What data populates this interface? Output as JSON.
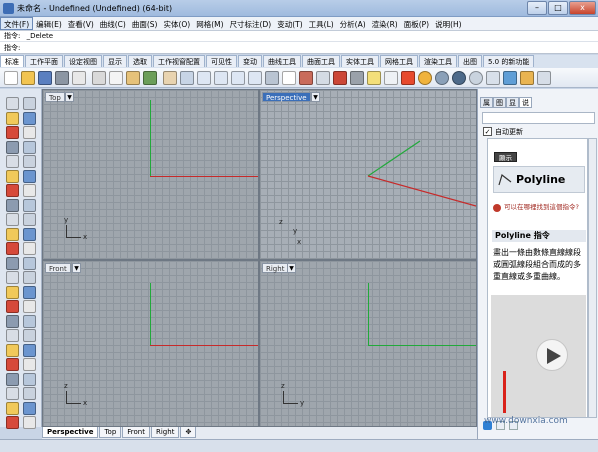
{
  "window": {
    "title": "未命名 - Undefined (Undefined) (64-bit)",
    "buttons": {
      "minimize": "–",
      "maximize": "□",
      "close": "x"
    }
  },
  "menu": [
    "文件(F)",
    "编辑(E)",
    "查看(V)",
    "曲线(C)",
    "曲面(S)",
    "实体(O)",
    "网格(M)",
    "尺寸标注(D)",
    "变动(T)",
    "工具(L)",
    "分析(A)",
    "渲染(R)",
    "面板(P)",
    "说明(H)"
  ],
  "command": {
    "history_label": "指令:",
    "history_value": "_Delete",
    "prompt_label": "指令:"
  },
  "toolbar_tabs": [
    "标准",
    "工作平面",
    "设定视图",
    "显示",
    "选取",
    "工作视窗配置",
    "可见性",
    "变动",
    "曲线工具",
    "曲面工具",
    "实体工具",
    "网格工具",
    "渲染工具",
    "出图",
    "5.0 的新功能"
  ],
  "viewports": {
    "top": {
      "label": "Top",
      "axis_x": "x",
      "axis_y": "y"
    },
    "perspective": {
      "label": "Perspective",
      "axis_x": "x",
      "axis_y": "y",
      "axis_z": "z"
    },
    "front": {
      "label": "Front",
      "axis_x": "x",
      "axis_z": "z"
    },
    "right": {
      "label": "Right",
      "axis_y": "y",
      "axis_z": "z"
    }
  },
  "viewport_tabs": [
    "Perspective",
    "Top",
    "Front",
    "Right"
  ],
  "viewport_tab_add": "✥",
  "right_panel": {
    "tabs": [
      "属",
      "图",
      "显",
      "说"
    ],
    "auto_update_label": "自动更新",
    "auto_update_checked": true,
    "show_button": "顯示",
    "command_name": "Polyline",
    "hint_text": "可以在哪裡找到這個指令?",
    "section_title": "Polyline 指令",
    "description": "畫出一條由數條直線線段或圓弧線段組合而成的多重直線或多重曲線。"
  },
  "watermark": "www.downxia.com",
  "colors": {
    "x_axis": "#c62a2a",
    "y_axis": "#21a93a",
    "active_viewport": "#3b6fb9"
  }
}
